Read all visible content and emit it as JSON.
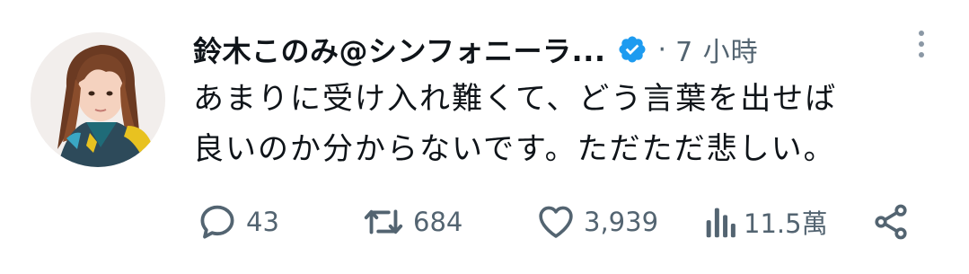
{
  "tweet": {
    "author_name": "鈴木このみ@シンフォニーラ...",
    "separator": "·",
    "time": "7 小時",
    "text_lines": [
      "あまりに受け入れ難くて、どう言葉を出せば",
      "良いのか分からないです。ただただ悲しい。"
    ]
  },
  "actions": {
    "reply_count": "43",
    "retweet_count": "684",
    "like_count": "3,939",
    "view_count": "11.5萬"
  },
  "icons": {
    "verified": "verified-badge-icon",
    "more": "more-vertical-icon",
    "reply": "reply-icon",
    "retweet": "retweet-icon",
    "like": "heart-icon",
    "views": "bar-chart-icon",
    "share": "share-icon"
  },
  "colors": {
    "text_primary": "#0f1419",
    "text_secondary": "#536471",
    "verified_blue": "#1d9bf0"
  }
}
